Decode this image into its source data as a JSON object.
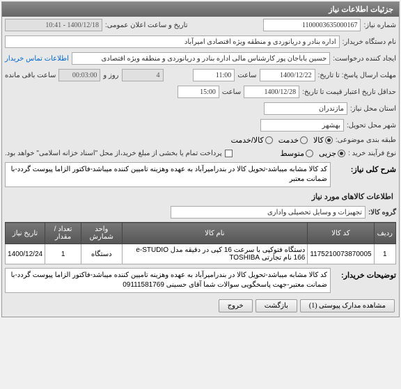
{
  "panel1_title": "جزئیات اطلاعات نیاز",
  "labels": {
    "need_number": "شماره نیاز:",
    "announce_datetime": "تاریخ و ساعت اعلان عمومی:",
    "buyer_org": "نام دستگاه خریدار:",
    "requester": "ایجاد کننده درخواست:",
    "contact_info": "اطلاعات تماس خریدار",
    "response_deadline": "مهلت ارسال پاسخ: تا تاریخ:",
    "hour": "ساعت",
    "days_and": "روز و",
    "remaining": "ساعت باقی مانده",
    "validity_deadline": "حداقل تاریخ اعتبار قیمت تا تاریخ:",
    "need_province": "استان محل نیاز:",
    "delivery_city": "شهر محل تحویل:",
    "classification": "طبقه بندی موضوعی:",
    "purchase_process": "نوع فرآیند خرید :",
    "general_desc": "شرح کلی نیاز:",
    "items_info": "اطلاعات کالاهای مورد نیاز",
    "item_group": "گروه کالا:",
    "buyer_notes": "توضیحات خریدار:"
  },
  "values": {
    "need_number": "1100003635000167",
    "announce_datetime": "1400/12/18 - 10:41",
    "buyer_org": "اداره بنادر و دریانوردی و منطقه ویژه اقتصادی امیرآباد",
    "requester": "حسین باباجان پور کارشناس مالی اداره بنادر و دریانوردی و منطقه ویژه اقتصادی",
    "response_date": "1400/12/22",
    "response_hour": "11:00",
    "remaining_days": "4",
    "remaining_time": "00:03:00",
    "validity_date": "1400/12/28",
    "validity_hour": "15:00",
    "need_province": "مازندران",
    "delivery_city": "بهشهر",
    "payment_note": "پرداخت تمام یا بخشی از مبلغ خرید،از محل \"اسناد خزانه اسلامی\" خواهد بود.",
    "general_desc": "کد کالا مشابه میباشد-تحویل کالا در بندرامیرآباد به عهده وهزینه تامیین کننده میباشد-فاکتور الزاما پیوست گردد-با ضمانت معتبر",
    "item_group": "تجهیزات و وسایل تحصیلی واداری",
    "buyer_notes": "کد کالا مشابه میباشد-تحویل کالا در بندرامیرآباد به عهده وهزینه تامیین کننده میباشد-فاکتور الزاما پیوست گردد-با ضمانت معتبر-جهت پاسخگویی سوالات شما آقای حسینی 09111581769"
  },
  "radios": {
    "classification": [
      {
        "label": "کالا",
        "checked": true
      },
      {
        "label": "خدمت",
        "checked": false
      },
      {
        "label": "کالا/خدمت",
        "checked": false
      }
    ],
    "purchase_process": [
      {
        "label": "جزیی",
        "checked": true
      },
      {
        "label": "متوسط",
        "checked": false
      }
    ]
  },
  "table": {
    "headers": [
      "ردیف",
      "کد کالا",
      "نام کالا",
      "واحد شمارش",
      "تعداد / مقدار",
      "تاریخ نیاز"
    ],
    "rows": [
      {
        "idx": "1",
        "code": "1175210073870005",
        "name": "دستگاه فتوکپی با سرعت 16 کپی در دقیقه مدل e-STUDIO 166 نام تجارتی TOSHIBA",
        "unit": "دستگاه",
        "qty": "1",
        "date": "1400/12/24"
      }
    ]
  },
  "buttons": {
    "attachments": "مشاهده مدارک پیوستی (1)",
    "back": "بازگشت",
    "exit": "خروج"
  }
}
